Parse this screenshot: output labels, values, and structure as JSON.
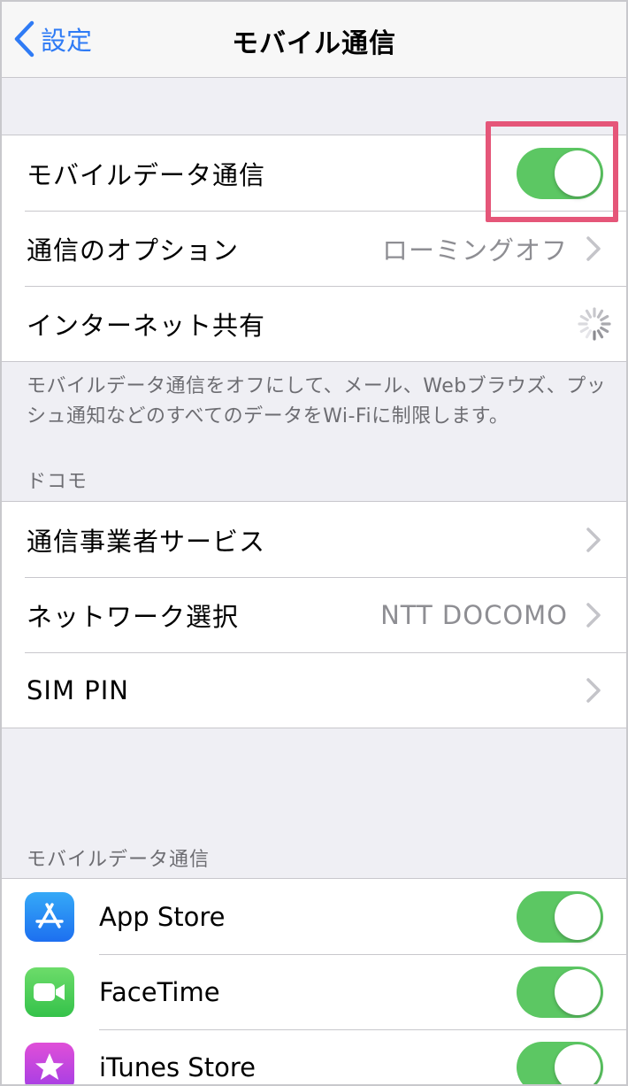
{
  "navbar": {
    "back_label": "設定",
    "title": "モバイル通信"
  },
  "group1": {
    "rows": [
      {
        "label": "モバイルデータ通信",
        "toggle_on": true
      },
      {
        "label": "通信のオプション",
        "value": "ローミングオフ"
      },
      {
        "label": "インターネット共有",
        "loading": true
      }
    ],
    "footer": "モバイルデータ通信をオフにして、メール、Webブラウズ、プッシュ通知などのすべてのデータをWi-Fiに制限します。"
  },
  "carrier_section": {
    "header": "ドコモ",
    "rows": [
      {
        "label": "通信事業者サービス"
      },
      {
        "label": "ネットワーク選択",
        "value": "NTT DOCOMO"
      },
      {
        "label": "SIM PIN"
      }
    ]
  },
  "apps_section": {
    "header": "モバイルデータ通信",
    "apps": [
      {
        "name": "App Store",
        "icon": "app-store-icon",
        "toggle_on": true
      },
      {
        "name": "FaceTime",
        "icon": "facetime-icon",
        "toggle_on": true
      },
      {
        "name": "iTunes Store",
        "icon": "itunes-store-icon",
        "toggle_on": true
      }
    ]
  },
  "colors": {
    "accent": "#2f7bf5",
    "toggle_on": "#5cc763",
    "highlight": "#e55679"
  }
}
